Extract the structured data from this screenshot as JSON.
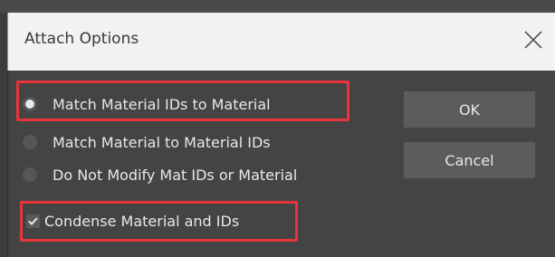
{
  "dialog": {
    "title": "Attach Options",
    "close_icon": "close-icon"
  },
  "options": [
    {
      "label": "Match Material IDs to Material",
      "selected": true,
      "highlighted": true
    },
    {
      "label": "Match Material to Material IDs",
      "selected": false,
      "highlighted": false
    },
    {
      "label": "Do Not Modify Mat IDs or Material",
      "selected": false,
      "highlighted": false
    }
  ],
  "condense": {
    "label": "Condense Material and IDs",
    "checked": true,
    "highlighted": true
  },
  "buttons": {
    "ok_label": "OK",
    "cancel_label": "Cancel"
  },
  "colors": {
    "highlight": "#e8343a",
    "panel": "#444444",
    "title_bar": "#f2f2f2"
  }
}
